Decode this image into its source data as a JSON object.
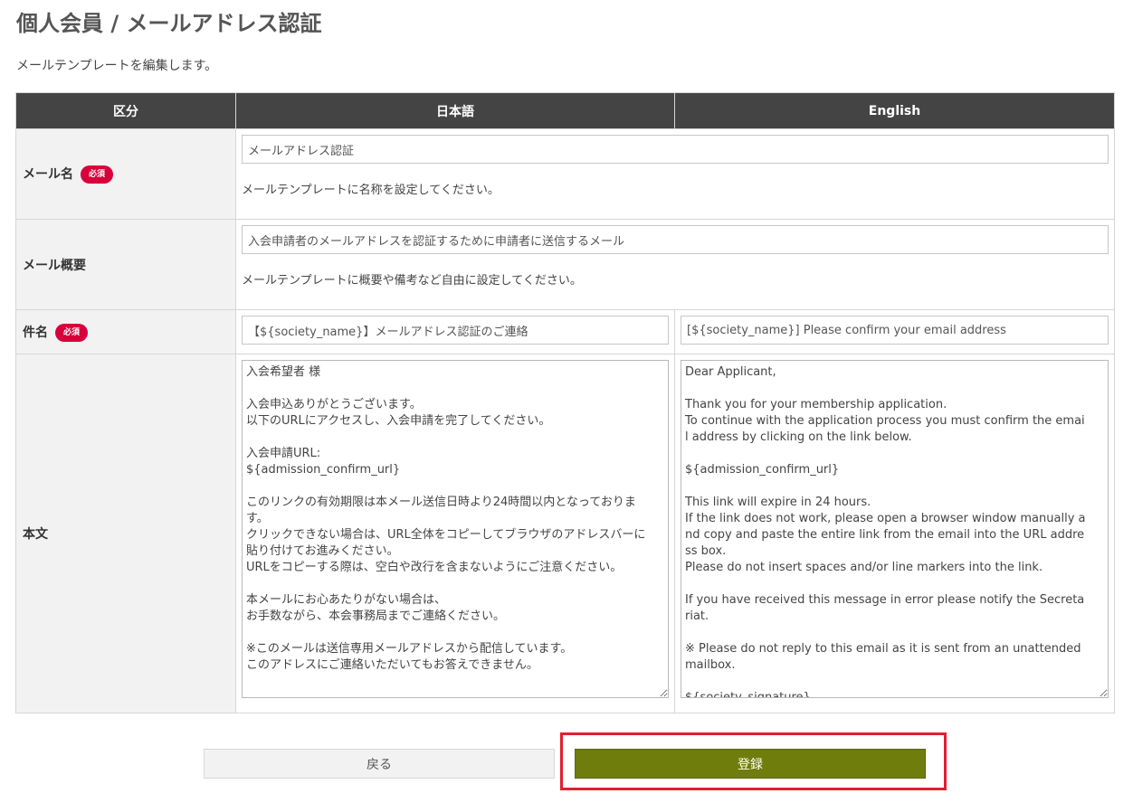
{
  "page": {
    "title": "個人会員 / メールアドレス認証",
    "description": "メールテンプレートを編集します。"
  },
  "table": {
    "headers": {
      "category": "区分",
      "japanese": "日本語",
      "english": "English"
    },
    "required_badge": "必須",
    "rows": {
      "mail_name": {
        "label": "メール名",
        "value": "メールアドレス認証",
        "hint": "メールテンプレートに名称を設定してください。"
      },
      "summary": {
        "label": "メール概要",
        "value": "入会申請者のメールアドレスを認証するために申請者に送信するメール",
        "hint": "メールテンプレートに概要や備考など自由に設定してください。"
      },
      "subject": {
        "label": "件名",
        "value_ja": "【${society_name}】メールアドレス認証のご連絡",
        "value_en": "[${society_name}] Please confirm your email address"
      },
      "body": {
        "label": "本文",
        "value_ja": "入会希望者 様\n\n入会申込ありがとうございます。\n以下のURLにアクセスし、入会申請を完了してください。\n\n入会申請URL:\n${admission_confirm_url}\n\nこのリンクの有効期限は本メール送信日時より24時間以内となっております。\nクリックできない場合は、URL全体をコピーしてブラウザのアドレスバーに貼り付けてお進みください。\nURLをコピーする際は、空白や改行を含まないようにご注意ください。\n\n本メールにお心あたりがない場合は、\nお手数ながら、本会事務局までご連絡ください。\n\n※このメールは送信専用メールアドレスから配信しています。\nこのアドレスにご連絡いただいてもお答えできません。",
        "value_en": "Dear Applicant,\n\nThank you for your membership application.\nTo continue with the application process you must confirm the email address by clicking on the link below.\n\n${admission_confirm_url}\n\nThis link will expire in 24 hours.\nIf the link does not work, please open a browser window manually and copy and paste the entire link from the email into the URL address box.\nPlease do not insert spaces and/or line markers into the link.\n\nIf you have received this message in error please notify the Secretariat.\n\n※ Please do not reply to this email as it is sent from an unattended mailbox.\n\n${society_signature}"
      }
    }
  },
  "buttons": {
    "back": "戻る",
    "register": "登録"
  },
  "colors": {
    "header_bg": "#444444",
    "required_badge": "#d7003a",
    "register_button": "#6f7d0d",
    "highlight_border": "#e02030"
  }
}
